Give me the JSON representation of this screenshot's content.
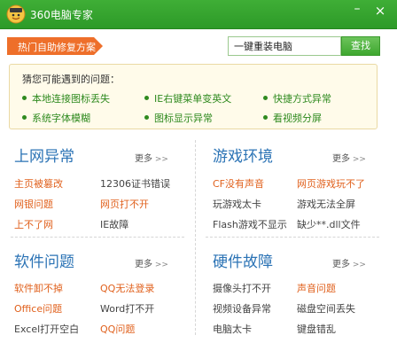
{
  "app": {
    "title": "360电脑专家"
  },
  "window": {
    "minimize": "–",
    "close": "×"
  },
  "hot_tag": {
    "label": "热门自助修复方案"
  },
  "search": {
    "value": "一键重装电脑",
    "button": "查找"
  },
  "guess": {
    "title": "猜您可能遇到的问题：",
    "items": [
      "本地连接图标丢失",
      "IE右键菜单变英文",
      "快捷方式异常",
      "系统字体模糊",
      "图标显示异常",
      "看视频分屏"
    ]
  },
  "more_label": "更多",
  "sections": {
    "internet": {
      "title": "上网异常",
      "links": [
        "主页被篡改",
        "12306证书错误",
        "网银问题",
        "网页打不开",
        "上不了网",
        "IE故障"
      ]
    },
    "games": {
      "title": "游戏环境",
      "links": [
        "CF没有声音",
        "网页游戏玩不了",
        "玩游戏太卡",
        "游戏无法全屏",
        "Flash游戏不显示",
        "缺少**.dll文件"
      ]
    },
    "software": {
      "title": "软件问题",
      "links": [
        "软件卸不掉",
        "QQ无法登录",
        "Office问题",
        "Word打不开",
        "Excel打开空白",
        "QQ问题"
      ]
    },
    "hardware": {
      "title": "硬件故障",
      "links": [
        "摄像头打不开",
        "声音问题",
        "视频设备异常",
        "磁盘空间丢失",
        "电脑太卡",
        "键盘错乱"
      ]
    }
  },
  "colors": {
    "brand_green": "#2d9a28",
    "title_blue": "#2b73b5",
    "hot_orange": "#e0601c",
    "tag_orange": "#ee6f2a"
  },
  "icons": {
    "logo": "mascot-icon",
    "bullet": "dot-icon",
    "more_arrow": "double-chevron-right-icon"
  }
}
